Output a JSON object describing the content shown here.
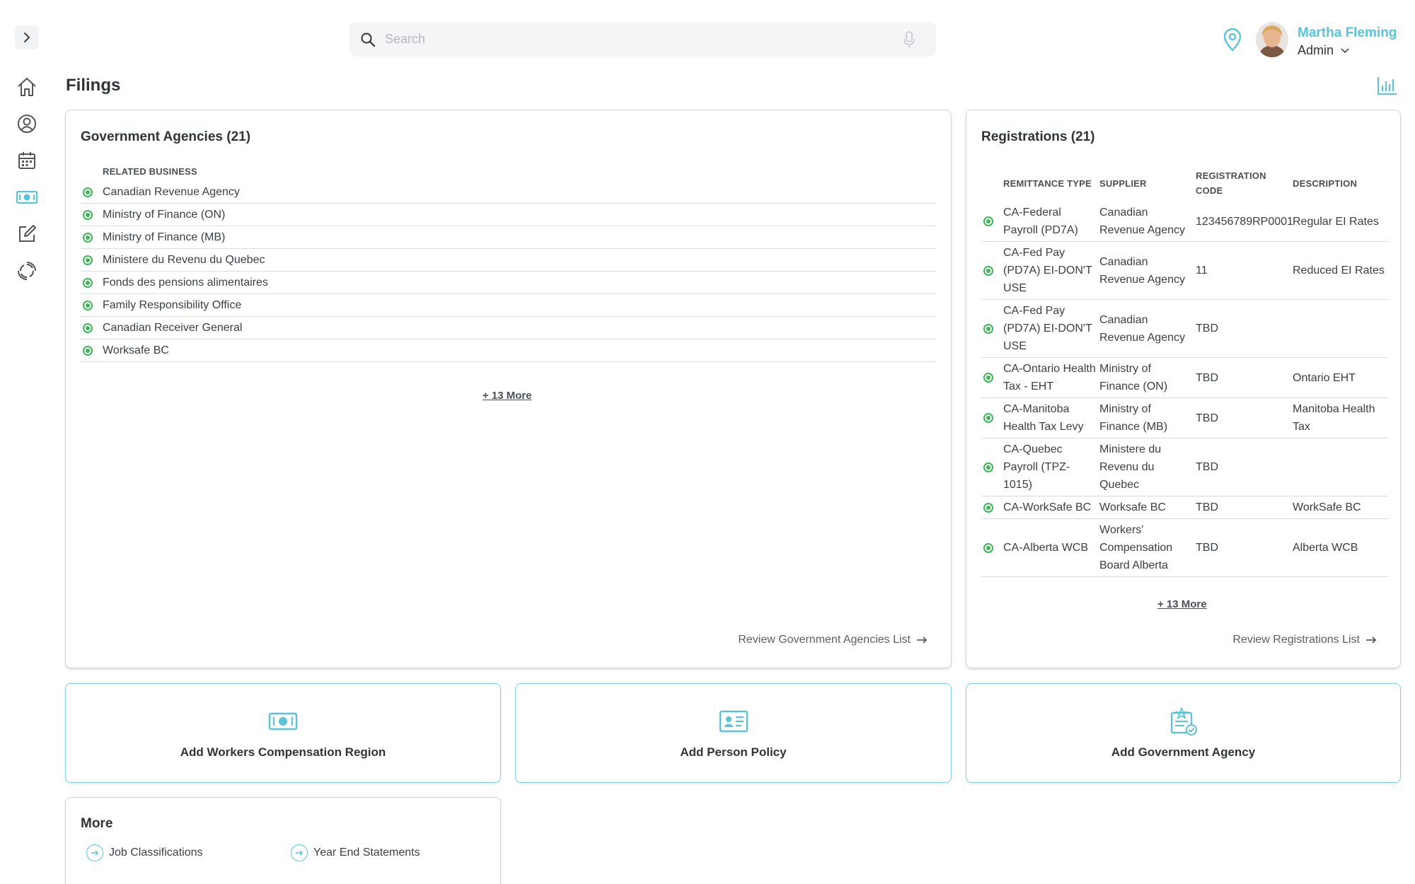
{
  "search": {
    "placeholder": "Search"
  },
  "user": {
    "name": "Martha Fleming",
    "role": "Admin"
  },
  "page": {
    "title": "Filings"
  },
  "sidebar": {
    "items": [
      {
        "icon": "home-icon"
      },
      {
        "icon": "user-circle-icon"
      },
      {
        "icon": "calendar-icon"
      },
      {
        "icon": "money-icon",
        "active": true
      },
      {
        "icon": "edit-icon"
      },
      {
        "icon": "sync-icon"
      }
    ]
  },
  "gov_agencies": {
    "title": "Government Agencies (21)",
    "column": "RELATED BUSINESS",
    "rows": [
      "Canadian Revenue Agency",
      "Ministry of Finance (ON)",
      "Ministry of Finance (MB)",
      "Ministere du Revenu du Quebec",
      "Fonds des pensions alimentaires",
      "Family Responsibility Office",
      "Canadian Receiver General",
      "Worksafe BC"
    ],
    "more": "+ 13 More",
    "review": "Review Government Agencies List"
  },
  "registrations": {
    "title": "Registrations (21)",
    "columns": {
      "type": "REMITTANCE TYPE",
      "supplier": "SUPPLIER",
      "code": "REGISTRATION CODE",
      "description": "DESCRIPTION"
    },
    "rows": [
      {
        "type": "CA-Federal Payroll (PD7A)",
        "supplier": "Canadian Revenue Agency",
        "code": "123456789RP0001",
        "description": "Regular EI Rates"
      },
      {
        "type": "CA-Fed Pay (PD7A) EI-DON'T USE",
        "supplier": "Canadian Revenue Agency",
        "code": "11",
        "description": "Reduced EI Rates"
      },
      {
        "type": "CA-Fed Pay (PD7A) EI-DON'T USE",
        "supplier": "Canadian Revenue Agency",
        "code": "TBD",
        "description": ""
      },
      {
        "type": "CA-Ontario Health Tax - EHT",
        "supplier": "Ministry of Finance (ON)",
        "code": "TBD",
        "description": "Ontario EHT"
      },
      {
        "type": "CA-Manitoba Health Tax Levy",
        "supplier": "Ministry of Finance (MB)",
        "code": "TBD",
        "description": "Manitoba Health Tax"
      },
      {
        "type": "CA-Quebec Payroll (TPZ-1015)",
        "supplier": "Ministere du Revenu du Quebec",
        "code": "TBD",
        "description": ""
      },
      {
        "type": "CA-WorkSafe BC",
        "supplier": "Worksafe BC",
        "code": "TBD",
        "description": "WorkSafe BC"
      },
      {
        "type": "CA-Alberta WCB",
        "supplier": "Workers' Compensation Board Alberta",
        "code": "TBD",
        "description": "Alberta WCB"
      }
    ],
    "more": "+ 13 More",
    "review": "Review Registrations List"
  },
  "actions": [
    {
      "label": "Add Workers Compensation Region",
      "icon": "money-icon"
    },
    {
      "label": "Add Person Policy",
      "icon": "id-card-icon"
    },
    {
      "label": "Add Government Agency",
      "icon": "certificate-icon"
    }
  ],
  "more_section": {
    "title": "More",
    "items": [
      {
        "label": "Job Classifications"
      },
      {
        "label": "Year End Statements"
      }
    ]
  },
  "colors": {
    "accent": "#5bc3d8",
    "status_green": "#3fb55a"
  }
}
